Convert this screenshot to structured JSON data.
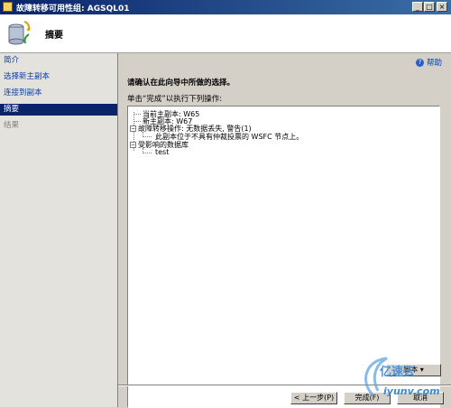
{
  "window": {
    "title": "故障转移可用性组: AGSQL01",
    "controls": {
      "minimize": "_",
      "maximize": "□",
      "close": "×"
    }
  },
  "header": {
    "title": "摘要",
    "icon": "database-migration-icon"
  },
  "nav": {
    "items": [
      {
        "label": "简介",
        "state": "link"
      },
      {
        "label": "选择新主副本",
        "state": "link"
      },
      {
        "label": "连接到副本",
        "state": "link"
      },
      {
        "label": "摘要",
        "state": "selected"
      },
      {
        "label": "结果",
        "state": "disabled"
      }
    ]
  },
  "content": {
    "help_label": "帮助",
    "instruction": "请确认在此向导中所做的选择。",
    "subtitle": "单击“完成”以执行下列操作:",
    "tree": {
      "current_primary": "当前主副本: W65",
      "new_primary": "新主副本: W67",
      "failover_op": "故障转移操作: 无数据丢失, 警告(1)",
      "failover_warning": "此副本位于不具有仲裁投票的 WSFC 节点上。",
      "affected_dbs": "受影响的数据库",
      "db": "test"
    }
  },
  "footer": {
    "script_label": "脚本",
    "back_label": "< 上一步(P)",
    "finish_label": "完成(F)",
    "cancel_label": "取消"
  },
  "watermark": {
    "line1": "亿速云",
    "line2": "iyunv.com"
  }
}
